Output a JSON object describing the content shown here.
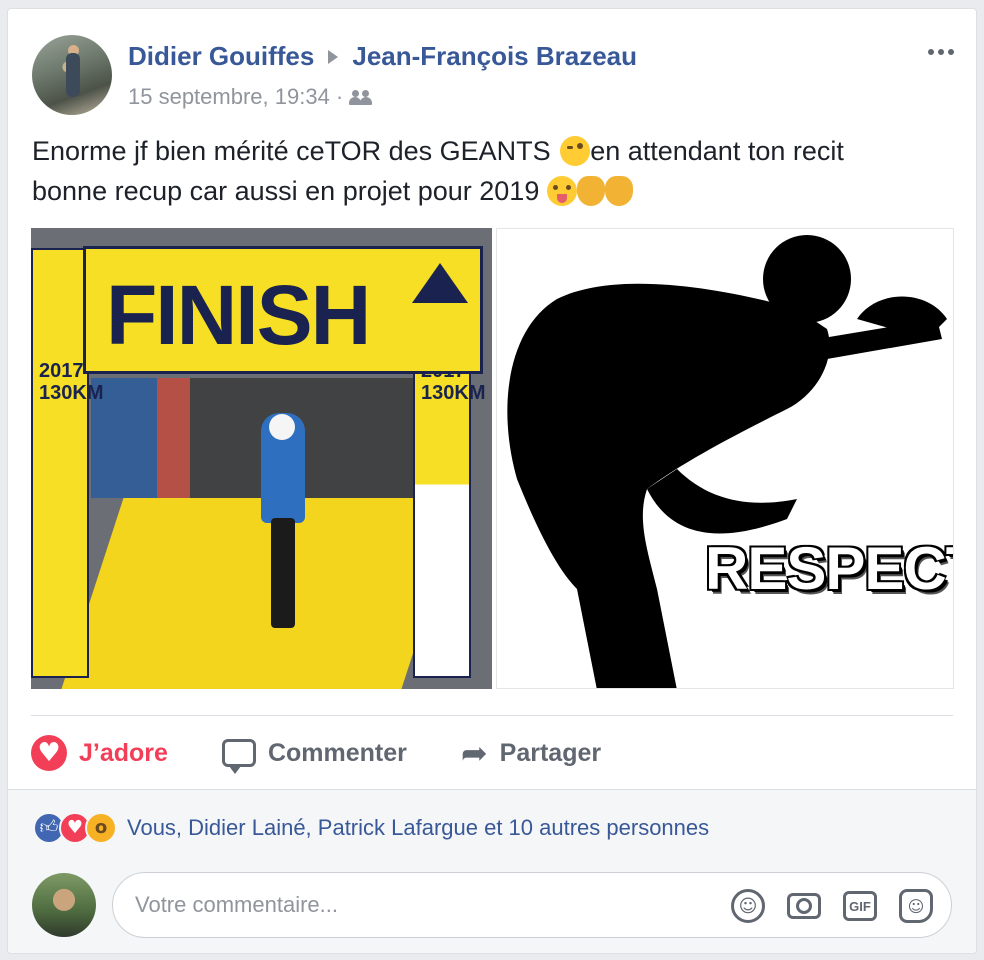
{
  "post": {
    "author": "Didier Gouiffes",
    "target": "Jean-François Brazeau",
    "timestamp": "15 septembre, 19:34",
    "separator": "·",
    "audience_icon": "friends-icon",
    "text_line1_a": "Enorme jf bien mérité ceTOR des GEANTS ",
    "text_line1_b": "en attendant ton recit",
    "text_line2": "bonne recup car aussi en projet pour 2019 ",
    "emojis": [
      "winking-tongue-emoji",
      "tongue-emoji",
      "clapping-hands-emoji",
      "clapping-hands-emoji"
    ]
  },
  "photo_left": {
    "banner_text": "FINISH",
    "pillar_text": "2017\n130KM"
  },
  "photo_right": {
    "caption": "RESPECT"
  },
  "actions": {
    "love_label": "J’adore",
    "comment_label": "Commenter",
    "share_label": "Partager"
  },
  "reactions": {
    "icons": [
      "like",
      "love",
      "wow"
    ],
    "summary": "Vous, Didier Lainé, Patrick Lafargue et 10 autres personnes"
  },
  "composer": {
    "placeholder": "Votre commentaire...",
    "gif_label": "GIF"
  },
  "colors": {
    "link": "#385898",
    "love": "#f33e58",
    "like": "#4267b2",
    "meta": "#90949c"
  }
}
